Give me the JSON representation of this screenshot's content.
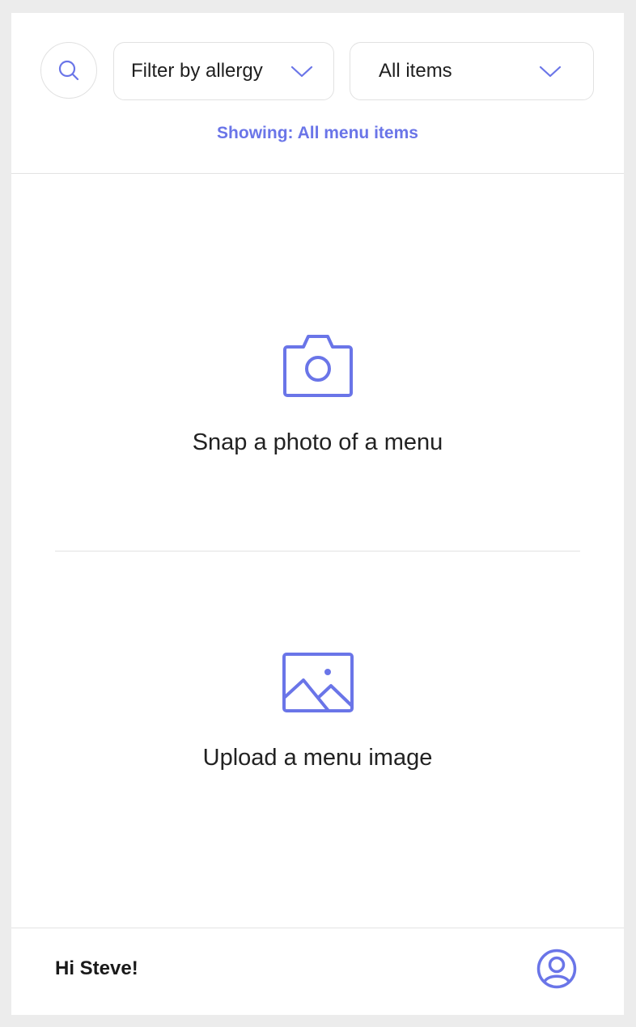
{
  "header": {
    "search": {
      "icon": "search-icon"
    },
    "allergy_filter": {
      "value": "Filter by allergy",
      "icon": "chevron-down-icon"
    },
    "items_filter": {
      "value": "All items",
      "icon": "chevron-down-icon"
    },
    "showing_text": "Showing: All menu items"
  },
  "actions": {
    "snap": {
      "icon": "camera-icon",
      "label": "Snap a photo of a menu"
    },
    "upload": {
      "icon": "image-icon",
      "label": "Upload a menu image"
    }
  },
  "footer": {
    "greeting": "Hi Steve!",
    "profile_icon": "user-circle-icon"
  },
  "colors": {
    "accent": "#6a75e8",
    "text": "#222222",
    "border": "#e1e1e1",
    "background": "#ececec"
  }
}
